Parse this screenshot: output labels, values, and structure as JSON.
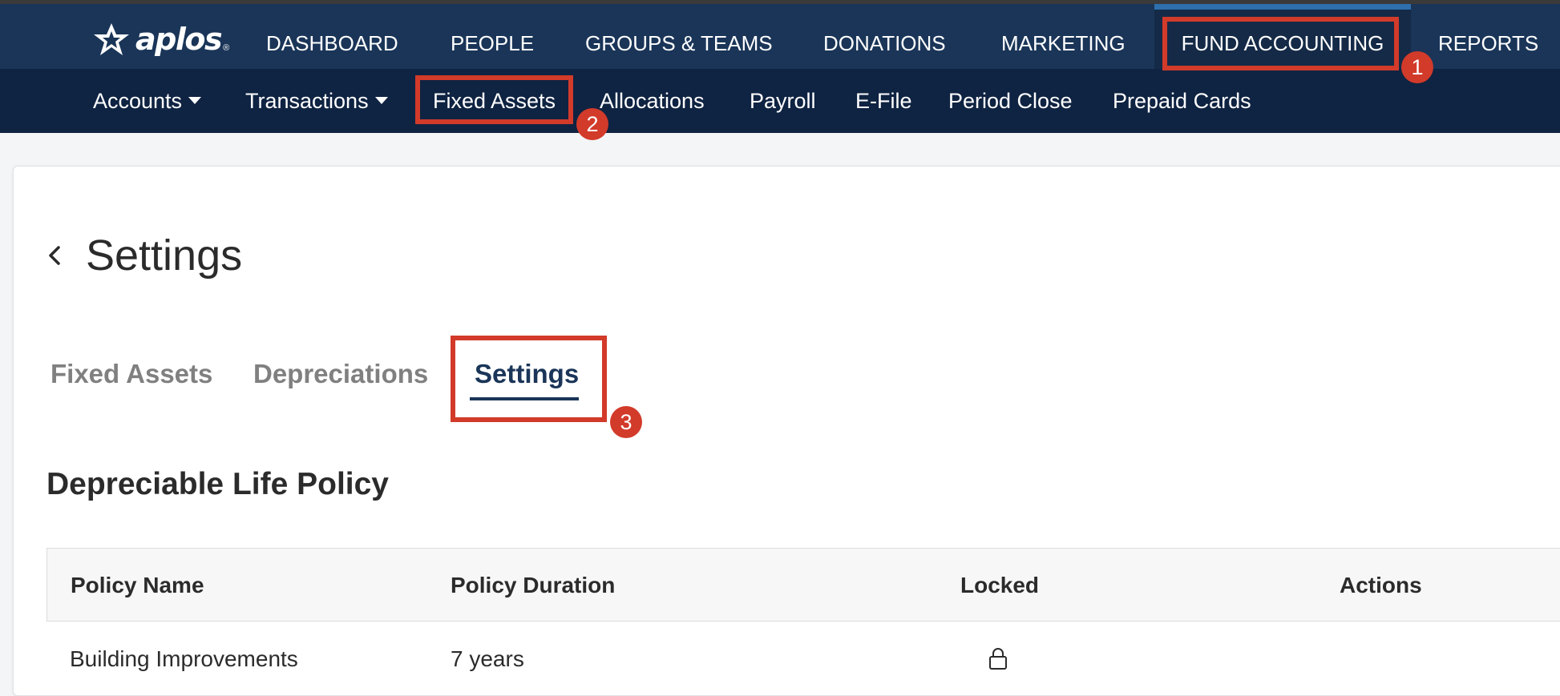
{
  "brand": {
    "logo_text": "aplos",
    "reg_mark": "®"
  },
  "top_nav": {
    "items": [
      {
        "label": "DASHBOARD"
      },
      {
        "label": "PEOPLE"
      },
      {
        "label": "GROUPS & TEAMS"
      },
      {
        "label": "DONATIONS"
      },
      {
        "label": "MARKETING"
      },
      {
        "label": "FUND ACCOUNTING",
        "active": true
      },
      {
        "label": "REPORTS"
      }
    ]
  },
  "sub_nav": {
    "items": [
      {
        "label": "Accounts",
        "dropdown": true
      },
      {
        "label": "Transactions",
        "dropdown": true
      },
      {
        "label": "Fixed Assets"
      },
      {
        "label": "Allocations"
      },
      {
        "label": "Payroll"
      },
      {
        "label": "E-File"
      },
      {
        "label": "Period Close"
      },
      {
        "label": "Prepaid Cards"
      }
    ]
  },
  "page": {
    "title": "Settings",
    "back_icon": "chevron-left-icon"
  },
  "tabs": [
    {
      "label": "Fixed Assets"
    },
    {
      "label": "Depreciations"
    },
    {
      "label": "Settings",
      "active": true
    }
  ],
  "section": {
    "title": "Depreciable Life Policy"
  },
  "table": {
    "columns": [
      "Policy Name",
      "Policy Duration",
      "Locked",
      "Actions"
    ],
    "rows": [
      {
        "policy_name": "Building Improvements",
        "duration": "7 years",
        "locked_icon": "lock-icon",
        "actions": ""
      }
    ]
  },
  "annotations": {
    "badges": [
      "1",
      "2",
      "3"
    ],
    "highlight_color": "#d23a2a"
  },
  "colors": {
    "nav_top": "#1a3558",
    "nav_sub": "#0f2342",
    "active_tab": "#1a3558",
    "active_indicator": "#2e6fae"
  }
}
